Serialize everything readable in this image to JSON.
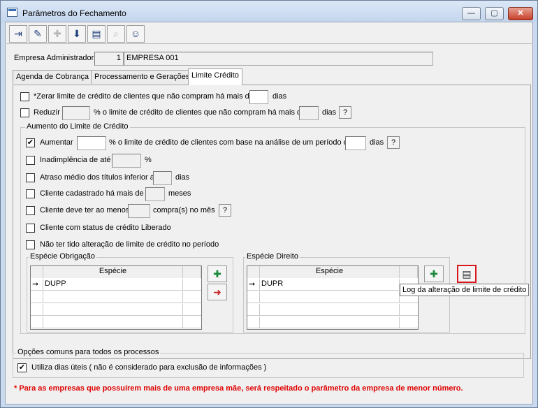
{
  "window": {
    "title": "Parâmetros do Fechamento",
    "minimize": "—",
    "maximize": "▢",
    "close": "✕"
  },
  "toolbar": {
    "icons": [
      "exit-icon",
      "eraser-icon",
      "add-icon",
      "save-icon",
      "open-folder-icon",
      "binoculars-icon",
      "user-help-icon"
    ],
    "glyphs": [
      "⇥",
      "✎",
      "✚",
      "⬇",
      "▤",
      "⌕",
      "☺"
    ]
  },
  "company": {
    "label": "Empresa Administradora",
    "code": "1",
    "name": "EMPRESA 001"
  },
  "tabs": [
    "Agenda de Cobrança",
    "Processamento e Gerações",
    "Limite Crédito"
  ],
  "limite": {
    "zerar": {
      "checked": "",
      "label": "*Zerar limite de crédito de clientes que não compram há mais de",
      "days_value": "",
      "unit": "dias"
    },
    "reduzir": {
      "checked": "",
      "label": "Reduzir",
      "percent_value": "",
      "mid": "% o limite de crédito de clientes que não compram há mais de",
      "days_value": "",
      "unit": "dias",
      "help": "?"
    },
    "aumento": {
      "title": "Aumento do Limite de Crédito",
      "aumentar": {
        "checked": "✔",
        "label": "Aumentar",
        "percent_value": "",
        "mid": "% o limite de crédito de clientes com base na análise de um período de",
        "days_value": "",
        "unit": "dias",
        "help": "?"
      },
      "inadimplencia": {
        "checked": "",
        "label": "Inadimplência de até",
        "value": "",
        "unit": "%"
      },
      "atraso": {
        "checked": "",
        "label": "Atraso médio dos títulos inferior a",
        "value": "",
        "unit": "dias"
      },
      "cadastro": {
        "checked": "",
        "label": "Cliente cadastrado há mais de",
        "value": "",
        "unit": "meses"
      },
      "compras": {
        "checked": "",
        "label": "Cliente deve ter ao menos",
        "value": "",
        "unit": "compra(s) no mês",
        "help": "?"
      },
      "status": {
        "checked": "",
        "label": "Cliente com status de crédito Liberado"
      },
      "nao_alterado": {
        "checked": "",
        "label": "Não ter tido alteração de limite de crédito no período"
      },
      "obrigacao": {
        "title": "Espécie Obrigação",
        "col": "Espécie",
        "rows": [
          "DUPP",
          "",
          "",
          ""
        ],
        "arrow": "➞"
      },
      "direito": {
        "title": "Espécie Direito",
        "col": "Espécie",
        "rows": [
          "DUPR",
          "",
          "",
          ""
        ],
        "arrow": "➞"
      }
    },
    "log_tooltip": "Log da alteração de limite de crédito"
  },
  "common": {
    "title": "Opções comuns para todos os processos",
    "dias_uteis": {
      "checked": "✔",
      "label": "Utiliza dias úteis ( não é considerado para exclusão de informações )"
    }
  },
  "footnote": "* Para as empresas que possuírem mais de uma empresa mãe, será respeitado o parâmetro da empresa de menor número.",
  "colors": {
    "footnote": "#e00000",
    "titlebar": "#c9d9ee",
    "log_button_border": "#d9181e"
  }
}
